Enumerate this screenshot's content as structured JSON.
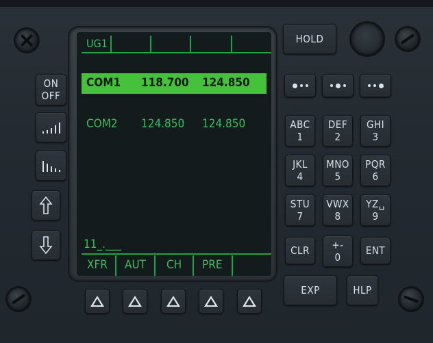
{
  "screen": {
    "header": "UG1",
    "row1": {
      "label": "COM1",
      "active": "118.700",
      "standby": "124.850"
    },
    "row2": {
      "label": "COM2",
      "active": "124.850",
      "standby": "124.850"
    },
    "scratchpad": "11_.___",
    "softkeys": [
      "XFR",
      "AUT",
      "CH",
      "PRE",
      ""
    ]
  },
  "left_buttons": {
    "on_off": {
      "line1": "ON",
      "line2": "OFF"
    }
  },
  "right_top": {
    "hold": "HOLD"
  },
  "keypad": [
    {
      "letters": "ABC",
      "digit": "1"
    },
    {
      "letters": "DEF",
      "digit": "2"
    },
    {
      "letters": "GHI",
      "digit": "3"
    },
    {
      "letters": "JKL",
      "digit": "4"
    },
    {
      "letters": "MNO",
      "digit": "5"
    },
    {
      "letters": "PQR",
      "digit": "6"
    },
    {
      "letters": "STU",
      "digit": "7"
    },
    {
      "letters": "VWX",
      "digit": "8"
    },
    {
      "letters": "YZ␣",
      "digit": "9"
    }
  ],
  "bottom_keys": {
    "clr": "CLR",
    "plusminus": "+-",
    "zero": "0",
    "ent": "ENT",
    "exp": "EXP",
    "hlp": "HLP"
  },
  "colors": {
    "screen_green": "#3dbc5d",
    "selection_bar": "#45c13c",
    "button_text": "#d7e2ea"
  }
}
